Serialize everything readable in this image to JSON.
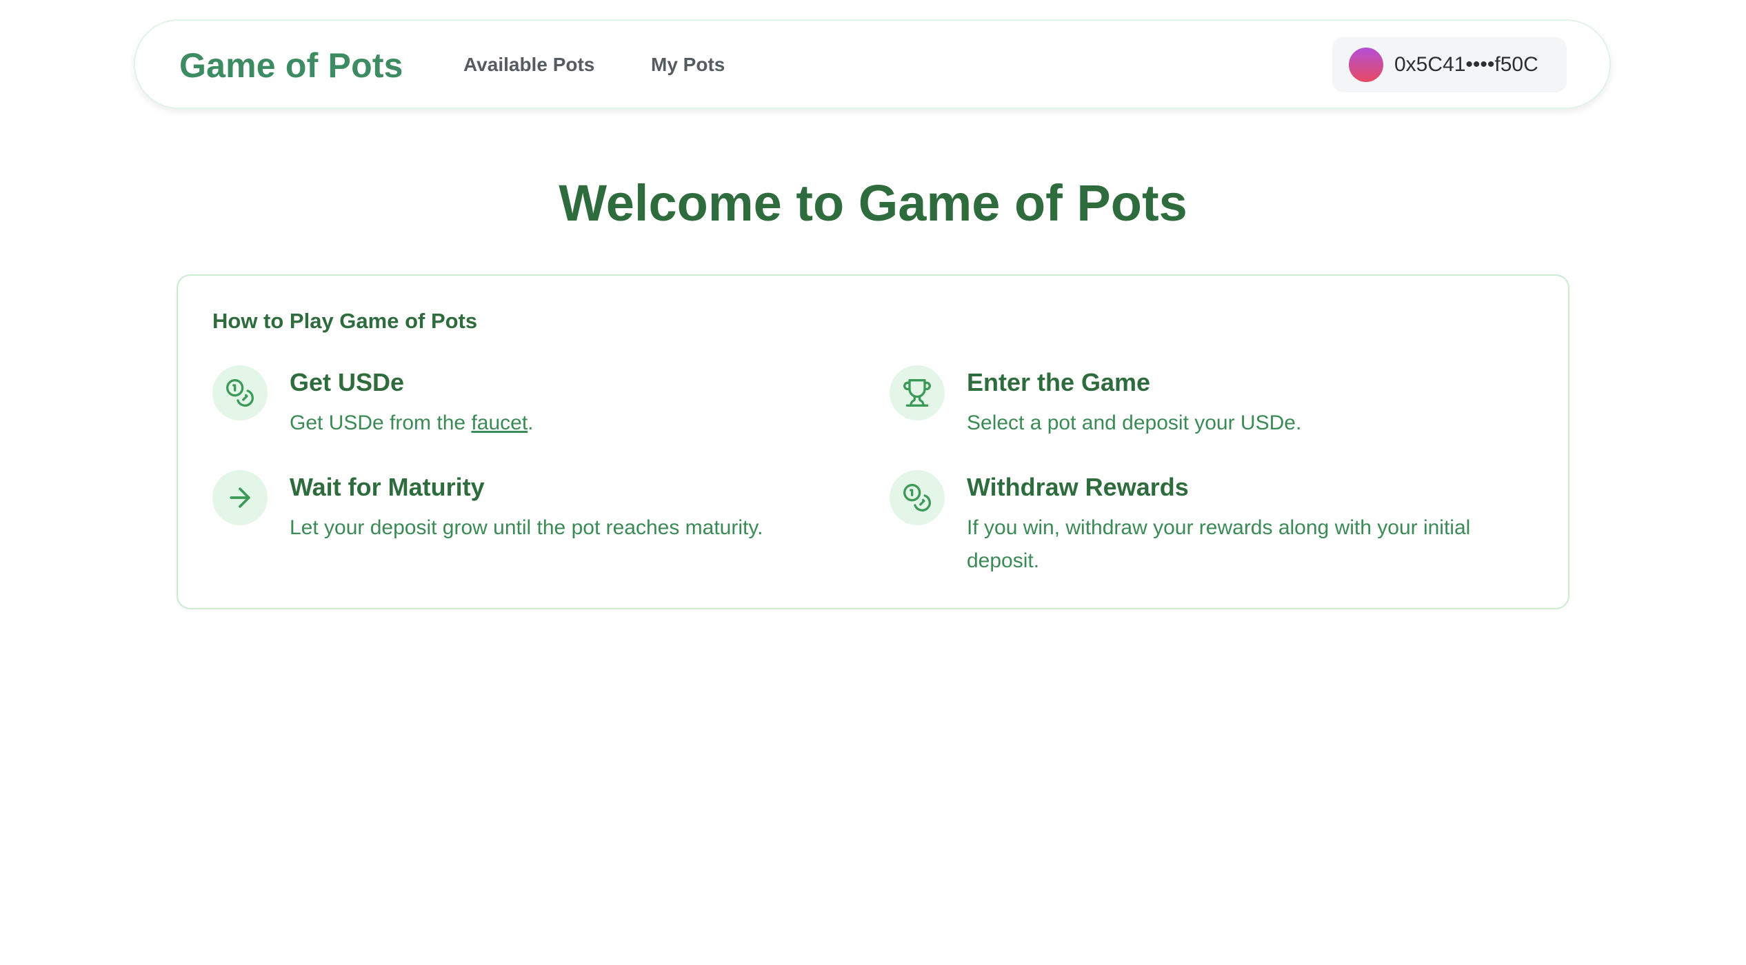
{
  "header": {
    "brand": "Game of Pots",
    "nav": {
      "available_pots": "Available Pots",
      "my_pots": "My Pots"
    },
    "wallet": {
      "address": "0x5C41••••f50C",
      "avatar_gradient": [
        "#b44fd6",
        "#e64a63"
      ]
    }
  },
  "main": {
    "title": "Welcome to Game of Pots",
    "how_to_play": {
      "title": "How to Play Game of Pots",
      "steps": [
        {
          "icon": "coins-icon",
          "title": "Get USDe",
          "text_before": "Get USDe from the ",
          "link": "faucet",
          "text_after": "."
        },
        {
          "icon": "trophy-icon",
          "title": "Enter the Game",
          "text": "Select a pot and deposit your USDe."
        },
        {
          "icon": "arrow-right-icon",
          "title": "Wait for Maturity",
          "text": "Let your deposit grow until the pot reaches maturity."
        },
        {
          "icon": "coins-icon",
          "title": "Withdraw Rewards",
          "text": "If you win, withdraw your rewards along with your initial deposit."
        }
      ]
    }
  },
  "colors": {
    "brand": "#3d8b62",
    "heading": "#2e6b3d",
    "body_text": "#3b8a55",
    "icon_bg": "#e3f6e8",
    "card_border": "#c9ecd2"
  }
}
